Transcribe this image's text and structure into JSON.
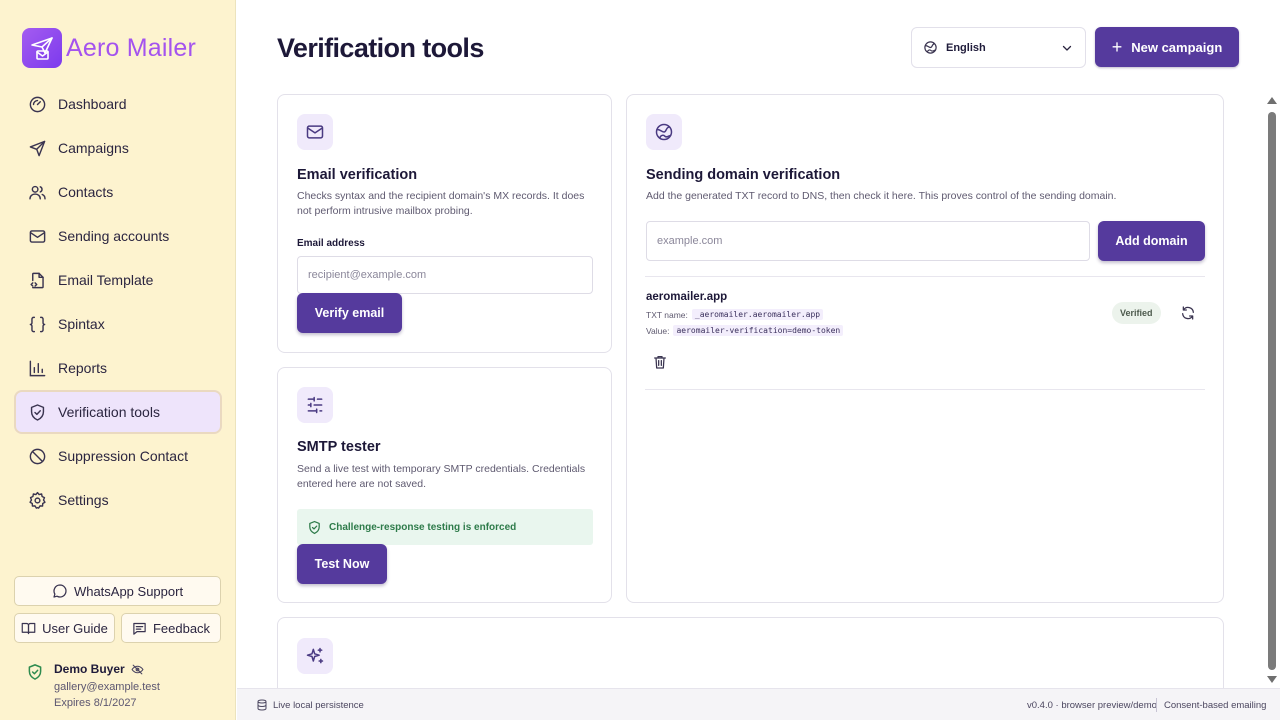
{
  "app": {
    "name": "Aero Mailer"
  },
  "sidebar": {
    "items": [
      {
        "label": "Dashboard",
        "icon": "gauge-icon"
      },
      {
        "label": "Campaigns",
        "icon": "send-icon"
      },
      {
        "label": "Contacts",
        "icon": "users-icon"
      },
      {
        "label": "Sending accounts",
        "icon": "mail-icon"
      },
      {
        "label": "Email Template",
        "icon": "file-code-icon"
      },
      {
        "label": "Spintax",
        "icon": "braces-icon"
      },
      {
        "label": "Reports",
        "icon": "bar-chart-icon"
      },
      {
        "label": "Verification tools",
        "icon": "shield-check-icon",
        "active": true
      },
      {
        "label": "Suppression Contact",
        "icon": "ban-icon"
      },
      {
        "label": "Settings",
        "icon": "gear-icon"
      }
    ],
    "whatsapp_label": "WhatsApp Support",
    "guide_label": "User Guide",
    "feedback_label": "Feedback",
    "user": {
      "name": "Demo Buyer",
      "email": "gallery@example.test",
      "expires": "Expires 8/1/2027"
    }
  },
  "header": {
    "title": "Verification tools",
    "language": "English",
    "new_campaign_label": "New campaign"
  },
  "email_verification": {
    "title": "Email verification",
    "description": "Checks syntax and the recipient domain's MX records. It does not perform intrusive mailbox probing.",
    "field_label": "Email address",
    "placeholder": "recipient@example.com",
    "button_label": "Verify email"
  },
  "smtp_tester": {
    "title": "SMTP tester",
    "description": "Send a live test with temporary SMTP credentials. Credentials entered here are not saved.",
    "notice": "Challenge-response testing is enforced",
    "button_label": "Test Now"
  },
  "domain_verification": {
    "title": "Sending domain verification",
    "description": "Add the generated TXT record to DNS, then check it here. This proves control of the sending domain.",
    "placeholder": "example.com",
    "button_label": "Add domain",
    "domains": [
      {
        "name": "aeromailer.app",
        "txt_label": "TXT name:",
        "txt_name": "_aeromailer.aeromailer.app",
        "value_label": "Value:",
        "value": "aeromailer-verification=demo-token",
        "status": "Verified"
      }
    ]
  },
  "footer": {
    "persistence": "Live local persistence",
    "version": "v0.4.0 · browser preview/demo",
    "consent": "Consent-based emailing"
  },
  "colors": {
    "accent": "#553a9d",
    "brand": "#a453ee",
    "sidebar_bg": "#fdf3cf",
    "success": "#2e7b4a"
  }
}
